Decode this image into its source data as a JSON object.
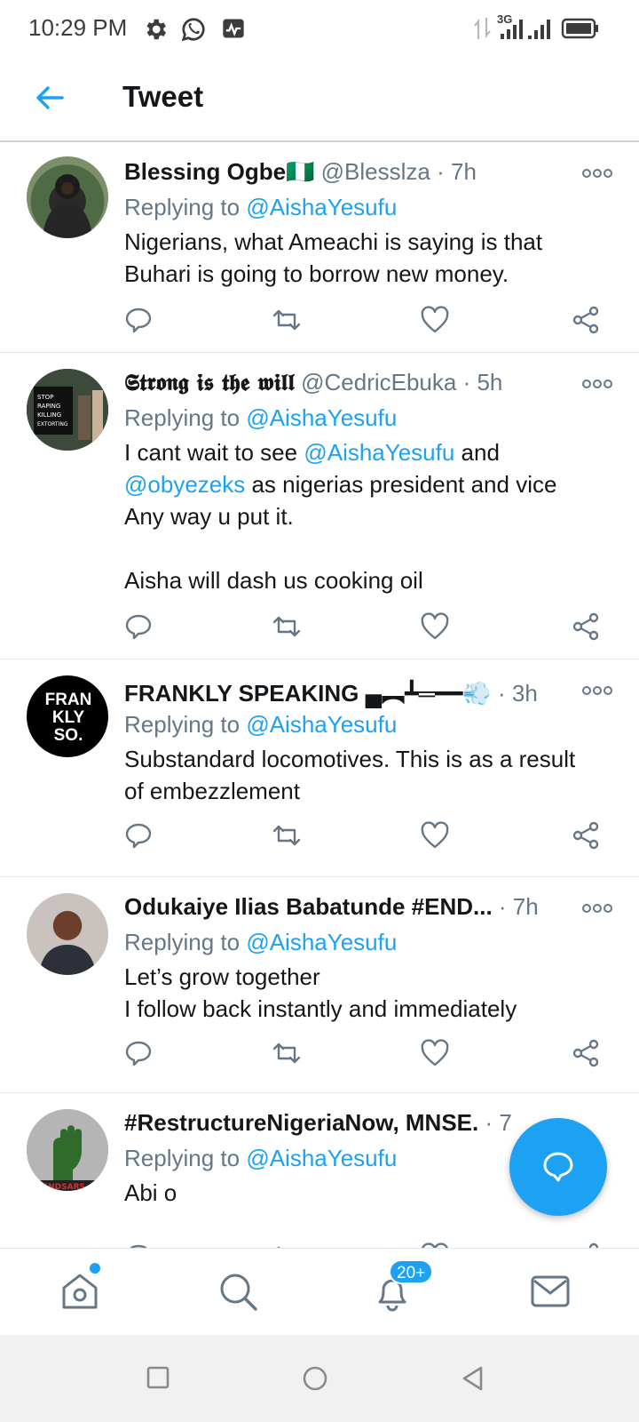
{
  "status_bar": {
    "time": "10:29 PM",
    "network": "3G"
  },
  "header": {
    "title": "Tweet"
  },
  "tweets": [
    {
      "name": "Blessing Ogbe🇳🇬",
      "handle": "@Blesslza",
      "time": "· 7h",
      "replying_prefix": "Replying to",
      "replying_to": "@AishaYesufu",
      "body_lines": [
        "Nigerians, what Ameachi is saying is that",
        "Buhari is going to borrow new money."
      ]
    },
    {
      "name": "𝕾𝖙𝖗𝖔𝖓𝖌 𝖎𝖘 𝖙𝖍𝖊 𝖜𝖎𝖑𝖑",
      "handle": "@CedricEbuka",
      "time": "· 5h",
      "replying_prefix": "Replying to",
      "replying_to": "@AishaYesufu",
      "body_parts": {
        "l1_pre": "I cant wait to see ",
        "l1_mention": "@AishaYesufu",
        "l1_post": " and",
        "l2_mention": "@obyezeks",
        "l2_post": " as nigerias president and vice",
        "l3": "Any way u put it.",
        "l5": "Aisha will dash us cooking oil"
      }
    },
    {
      "name": "FRANKLY SPEAKING ▄︻┻═━━💨",
      "handle": "",
      "time": "· 3h",
      "replying_prefix": "Replying to",
      "replying_to": "@AishaYesufu",
      "avatar_text": [
        "FRAN",
        "KLY",
        "SO."
      ],
      "body_lines": [
        "Substandard locomotives. This is as a result",
        "of embezzlement"
      ]
    },
    {
      "name": "Odukaiye Ilias Babatunde #END...",
      "handle": "",
      "time": "· 7h",
      "replying_prefix": "Replying to",
      "replying_to": "@AishaYesufu",
      "body_lines": [
        "Let’s grow together",
        "I follow back instantly and immediately"
      ]
    },
    {
      "name": "#RestructureNigeriaNow, MNSE.",
      "handle": "",
      "time": "· 7",
      "replying_prefix": "Replying to",
      "replying_to": "@AishaYesufu",
      "body_lines": [
        "Abi o"
      ]
    }
  ],
  "bottom_nav": {
    "notifications_badge": "20+"
  },
  "colors": {
    "accent": "#1da1f2",
    "text": "#14171a",
    "secondary": "#657786"
  }
}
